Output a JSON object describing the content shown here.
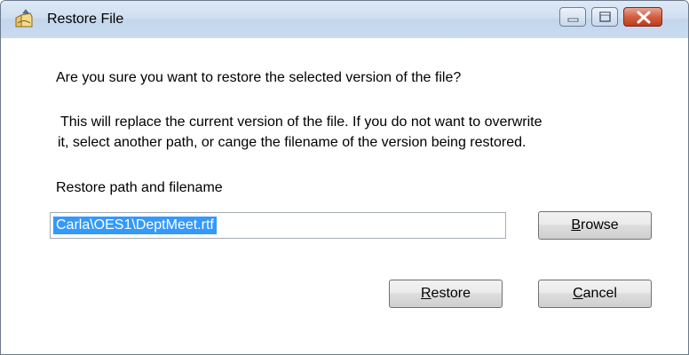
{
  "window": {
    "title": "Restore File",
    "title_icon": "restore-file-icon"
  },
  "title_buttons": {
    "minimize_icon": "minimize-icon",
    "maximize_icon": "maximize-icon",
    "close_icon": "close-icon"
  },
  "dialog": {
    "question": "Are you sure you want to restore the selected version of the file?",
    "info_line1": "This will replace the current version of the file. If you do not want to overwrite",
    "info_line2": "it, select another path, or cange the filename of the version being restored.",
    "path_label": "Restore path and filename",
    "path_value": "Carla\\OES1\\DeptMeet.rtf"
  },
  "buttons": {
    "browse_mnemonic": "B",
    "browse_rest": "rowse",
    "restore_mnemonic": "R",
    "restore_rest": "estore",
    "cancel_mnemonic": "C",
    "cancel_rest": "ancel"
  },
  "colors": {
    "selection": "#3399ff",
    "titlebar": "#cadbef",
    "close_button": "#c0391c"
  }
}
